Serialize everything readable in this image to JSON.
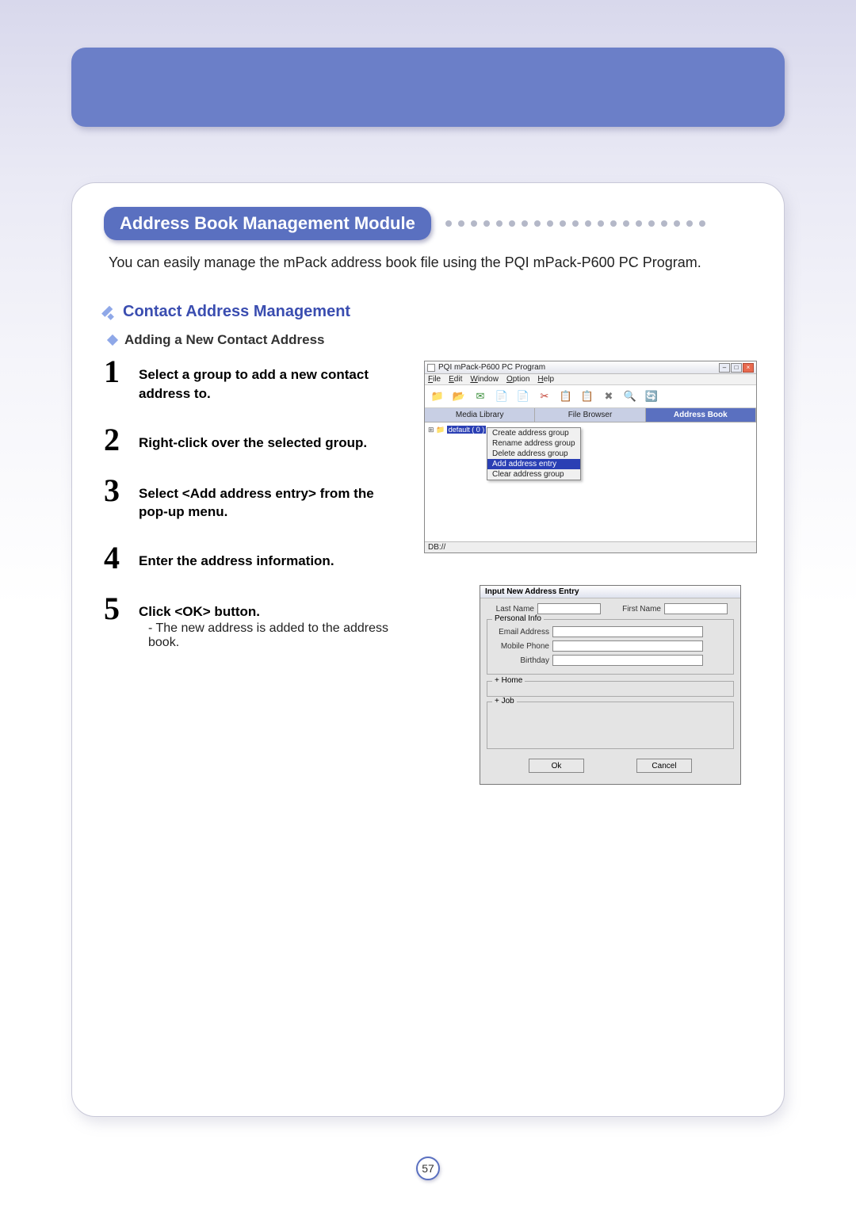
{
  "section_title": "Address Book Management Module",
  "intro": "You can easily manage the mPack address book file using the PQI mPack-P600 PC Program.",
  "subheading": "Contact Address Management",
  "subsubheading": "Adding a New Contact Address",
  "steps": [
    {
      "num": "1",
      "text": "Select a group to add a new contact address to."
    },
    {
      "num": "2",
      "text": "Right-click over the selected group."
    },
    {
      "num": "3",
      "text": "Select <Add address entry> from the pop-up menu."
    },
    {
      "num": "4",
      "text": "Enter the address information."
    },
    {
      "num": "5",
      "text": "Click <OK> button.",
      "note": "- The new address is added to the address book."
    }
  ],
  "screenshot_app": {
    "title": "PQI mPack-P600 PC Program",
    "menu": [
      "File",
      "Edit",
      "Window",
      "Option",
      "Help"
    ],
    "tabs": [
      "Media Library",
      "File Browser",
      "Address Book"
    ],
    "active_tab": 2,
    "tree_item": "default ( 0 )",
    "context_menu": [
      "Create address group",
      "Rename address group",
      "Delete address group",
      "Add address entry",
      "Clear address group"
    ],
    "context_menu_highlight": 3,
    "status": "DB://"
  },
  "dialog": {
    "title": "Input New Address Entry",
    "labels": {
      "last_name": "Last Name",
      "first_name": "First Name",
      "personal_info": "Personal Info",
      "email": "Email Address",
      "mobile": "Mobile Phone",
      "birthday": "Birthday",
      "home": "+ Home",
      "job": "+ Job",
      "ok": "Ok",
      "cancel": "Cancel"
    }
  },
  "page_number": "57"
}
